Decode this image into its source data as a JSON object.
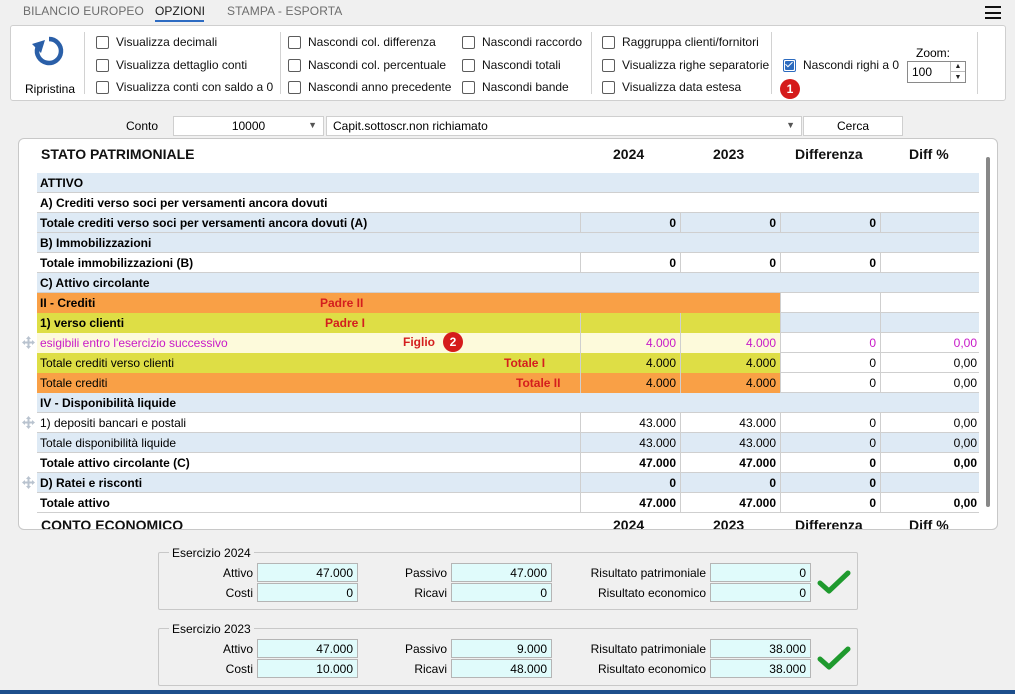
{
  "tabs": [
    "BILANCIO EUROPEO",
    "OPZIONI",
    "STAMPA - ESPORTA"
  ],
  "toolbar": {
    "reset_label": "Ripristina",
    "checkboxes": [
      {
        "label": "Visualizza decimali",
        "checked": false
      },
      {
        "label": "Visualizza dettaglio conti",
        "checked": false
      },
      {
        "label": "Visualizza conti con saldo a 0",
        "checked": false
      },
      {
        "label": "Nascondi col. differenza",
        "checked": false
      },
      {
        "label": "Nascondi col. percentuale",
        "checked": false
      },
      {
        "label": "Nascondi anno precedente",
        "checked": false
      },
      {
        "label": "Nascondi raccordo",
        "checked": false
      },
      {
        "label": "Nascondi totali",
        "checked": false
      },
      {
        "label": "Nascondi bande",
        "checked": false
      },
      {
        "label": "Raggruppa clienti/fornitori",
        "checked": false
      },
      {
        "label": "Visualizza righe separatorie",
        "checked": false
      },
      {
        "label": "Visualizza data estesa",
        "checked": false
      },
      {
        "label": "Nascondi righi a 0",
        "checked": true
      }
    ],
    "badge1": "1",
    "zoom_label": "Zoom:",
    "zoom_value": "100"
  },
  "conto": {
    "label": "Conto",
    "code": "10000",
    "description": "Capit.sottoscr.non richiamato",
    "search_label": "Cerca"
  },
  "report": {
    "header": {
      "title": "STATO PATRIMONIALE",
      "y1": "2024",
      "y2": "2023",
      "diff": "Differenza",
      "pct": "Diff %"
    },
    "rows": [
      {
        "desc": "ATTIVO",
        "v1": "",
        "v2": "",
        "v3": "",
        "v4": ""
      },
      {
        "desc": "A) Crediti verso soci per versamenti ancora dovuti",
        "v1": "",
        "v2": "",
        "v3": "",
        "v4": ""
      },
      {
        "desc": "Totale crediti verso soci per versamenti ancora dovuti (A)",
        "v1": "0",
        "v2": "0",
        "v3": "0",
        "v4": ""
      },
      {
        "desc": "B) Immobilizzazioni",
        "v1": "",
        "v2": "",
        "v3": "",
        "v4": ""
      },
      {
        "desc": "Totale immobilizzazioni (B)",
        "v1": "0",
        "v2": "0",
        "v3": "0",
        "v4": ""
      },
      {
        "desc": "C) Attivo circolante",
        "v1": "",
        "v2": "",
        "v3": "",
        "v4": ""
      },
      {
        "desc": "II - Crediti",
        "v1": "",
        "v2": "",
        "v3": "",
        "v4": ""
      },
      {
        "desc": "1) verso clienti",
        "v1": "",
        "v2": "",
        "v3": "",
        "v4": ""
      },
      {
        "desc": "esigibili entro l'esercizio successivo",
        "v1": "4.000",
        "v2": "4.000",
        "v3": "0",
        "v4": "0,00"
      },
      {
        "desc": "Totale crediti verso clienti",
        "v1": "4.000",
        "v2": "4.000",
        "v3": "0",
        "v4": "0,00"
      },
      {
        "desc": "Totale crediti",
        "v1": "4.000",
        "v2": "4.000",
        "v3": "0",
        "v4": "0,00"
      },
      {
        "desc": "IV - Disponibilità liquide",
        "v1": "",
        "v2": "",
        "v3": "",
        "v4": ""
      },
      {
        "desc": "1) depositi bancari e postali",
        "v1": "43.000",
        "v2": "43.000",
        "v3": "0",
        "v4": "0,00"
      },
      {
        "desc": "Totale disponibilità liquide",
        "v1": "43.000",
        "v2": "43.000",
        "v3": "0",
        "v4": "0,00"
      },
      {
        "desc": "Totale attivo circolante (C)",
        "v1": "47.000",
        "v2": "47.000",
        "v3": "0",
        "v4": "0,00"
      },
      {
        "desc": "D) Ratei e risconti",
        "v1": "0",
        "v2": "0",
        "v3": "0",
        "v4": ""
      },
      {
        "desc": "Totale attivo",
        "v1": "47.000",
        "v2": "47.000",
        "v3": "0",
        "v4": "0,00"
      }
    ],
    "highlights": {
      "padre2": "Padre II",
      "padre1": "Padre I",
      "figlio": "Figlio",
      "badge2": "2",
      "totale1": "Totale I",
      "totale2": "Totale II"
    },
    "footer_header": {
      "title": "CONTO ECONOMICO",
      "y1": "2024",
      "y2": "2023",
      "diff": "Differenza",
      "pct": "Diff %"
    }
  },
  "summary": [
    {
      "title": "Esercizio 2024",
      "attivo_label": "Attivo",
      "attivo": "47.000",
      "costi_label": "Costi",
      "costi": "0",
      "passivo_label": "Passivo",
      "passivo": "47.000",
      "ricavi_label": "Ricavi",
      "ricavi": "0",
      "rp_label": "Risultato patrimoniale",
      "rp": "0",
      "re_label": "Risultato economico",
      "re": "0"
    },
    {
      "title": "Esercizio 2023",
      "attivo_label": "Attivo",
      "attivo": "47.000",
      "costi_label": "Costi",
      "costi": "10.000",
      "passivo_label": "Passivo",
      "passivo": "9.000",
      "ricavi_label": "Ricavi",
      "ricavi": "48.000",
      "rp_label": "Risultato patrimoniale",
      "rp": "38.000",
      "re_label": "Risultato economico",
      "re": "38.000"
    }
  ],
  "colors": {
    "orange": "#f9a046",
    "yellow": "#dede45",
    "pale_yellow": "#fdfadb",
    "pink": "#c81ac8",
    "red": "#d41e1e",
    "green_check": "#1f9a2e",
    "accent": "#2c6bbf"
  }
}
